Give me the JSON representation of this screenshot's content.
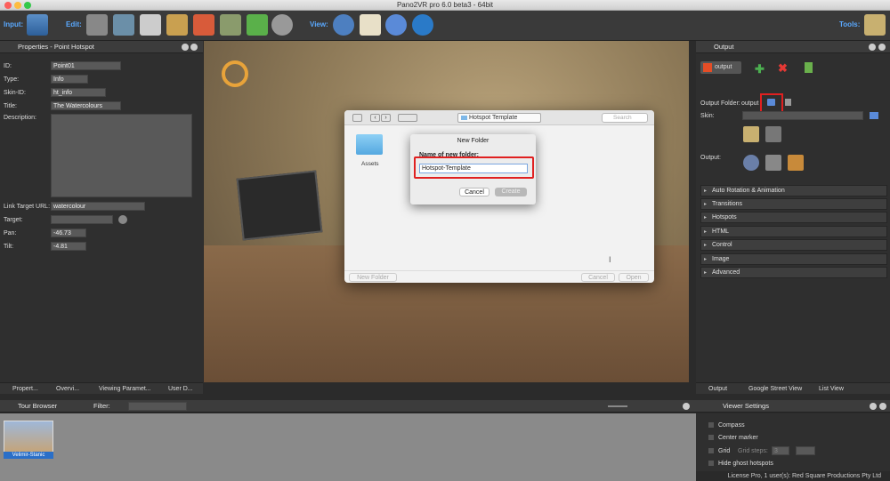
{
  "window": {
    "title": "Pano2VR pro 6.0 beta3 - 64bit"
  },
  "toolbar": {
    "input_label": "Input:",
    "edit_label": "Edit:",
    "view_label": "View:",
    "tools_label": "Tools:"
  },
  "properties": {
    "title": "Properties - Point Hotspot",
    "id_label": "ID:",
    "id_value": "Point01",
    "type_label": "Type:",
    "type_value": "Info",
    "skinid_label": "Skin-ID:",
    "skinid_value": "ht_info",
    "title_label": "Title:",
    "title_value": "The Watercolours",
    "description_label": "Description:",
    "link_label": "Link Target URL:",
    "link_value": "watercolour",
    "target_label": "Target:",
    "pan_label": "Pan:",
    "pan_value": "-46.73",
    "tilt_label": "Tilt:",
    "tilt_value": "-4.81"
  },
  "left_tabs": [
    "Propert...",
    "Overvi...",
    "Viewing Paramet...",
    "User D..."
  ],
  "finder": {
    "path": "Hotspot Template",
    "search_placeholder": "Search",
    "folder_name": "Assets",
    "new_folder_button": "New Folder",
    "cancel_button": "Cancel",
    "open_button": "Open"
  },
  "sheet": {
    "title": "New Folder",
    "prompt": "Name of new folder:",
    "input_value": "Hotspot-Template",
    "cancel": "Cancel",
    "create": "Create"
  },
  "output": {
    "title": "Output",
    "format": "output",
    "folder_label": "Output Folder:",
    "folder_value": "output",
    "skin_label": "Skin:",
    "output_label": "Output:",
    "sections": [
      "Auto Rotation & Animation",
      "Transitions",
      "Hotspots",
      "HTML",
      "Control",
      "Image",
      "Advanced"
    ]
  },
  "right_tabs": [
    "Output",
    "Google Street View",
    "List View"
  ],
  "tour_browser": {
    "title": "Tour Browser",
    "filter_label": "Filter:",
    "thumb_label": "Velimir-Stanic"
  },
  "viewer_settings": {
    "title": "Viewer Settings",
    "compass": "Compass",
    "center_marker": "Center marker",
    "grid": "Grid",
    "grid_steps": "Grid steps:",
    "grid_steps_value": "3",
    "hide_ghost": "Hide ghost hotspots"
  },
  "status": "License Pro, 1 user(s): Red Square Productions Pty Ltd",
  "colors": {
    "accent": "#5aa9ff",
    "highlight": "#e02020",
    "panel": "#2f2f2f"
  }
}
